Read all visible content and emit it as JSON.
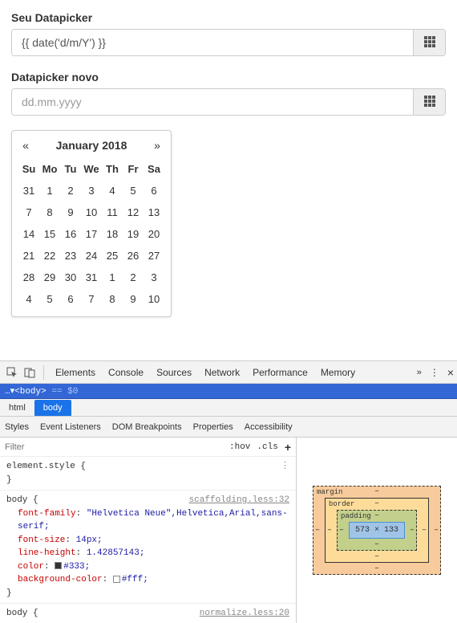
{
  "field1": {
    "label": "Seu Datapicker",
    "value": "{{ date('d/m/Y') }}"
  },
  "field2": {
    "label": "Datapicker novo",
    "placeholder": "dd.mm.yyyy"
  },
  "calendar": {
    "prev": "«",
    "next": "»",
    "title": "January 2018",
    "weekdays": [
      "Su",
      "Mo",
      "Tu",
      "We",
      "Th",
      "Fr",
      "Sa"
    ],
    "weeks": [
      [
        "31",
        "1",
        "2",
        "3",
        "4",
        "5",
        "6"
      ],
      [
        "7",
        "8",
        "9",
        "10",
        "11",
        "12",
        "13"
      ],
      [
        "14",
        "15",
        "16",
        "17",
        "18",
        "19",
        "20"
      ],
      [
        "21",
        "22",
        "23",
        "24",
        "25",
        "26",
        "27"
      ],
      [
        "28",
        "29",
        "30",
        "31",
        "1",
        "2",
        "3"
      ],
      [
        "4",
        "5",
        "6",
        "7",
        "8",
        "9",
        "10"
      ]
    ]
  },
  "devtools": {
    "tabs": [
      "Elements",
      "Console",
      "Sources",
      "Network",
      "Performance",
      "Memory"
    ],
    "overflow": "»",
    "breadcrumb_prefix": "…▾",
    "breadcrumb_body": "<body>",
    "breadcrumb_suffix": " == $0",
    "subtabs": [
      "html",
      "body"
    ],
    "panel_tabs": [
      "Styles",
      "Event Listeners",
      "DOM Breakpoints",
      "Properties",
      "Accessibility"
    ],
    "filter_placeholder": "Filter",
    "hov": ":hov",
    "cls": ".cls",
    "rule1_selector": "element.style {",
    "rule1_close": "}",
    "rule2_link": "scaffolding.less:32",
    "rule2_selector": "body {",
    "rule2_props": [
      {
        "name": "font-family",
        "colon": ": ",
        "value": "\"Helvetica Neue\",Helvetica,Arial,sans-serif;"
      },
      {
        "name": "font-size",
        "colon": ": ",
        "value": "14px;"
      },
      {
        "name": "line-height",
        "colon": ": ",
        "value": "1.42857143;"
      },
      {
        "name": "color",
        "colon": ": ",
        "value": "#333;",
        "swatch": "#333"
      },
      {
        "name": "background-color",
        "colon": ": ",
        "value": "#fff;",
        "swatch": "#fff"
      }
    ],
    "rule2_close": "}",
    "rule3_selector": "body {",
    "rule3_link": "normalize.less:20",
    "boxmodel": {
      "margin_label": "margin",
      "border_label": "border",
      "padding_label": "padding",
      "content": "573 × 133",
      "dash": "–"
    }
  }
}
